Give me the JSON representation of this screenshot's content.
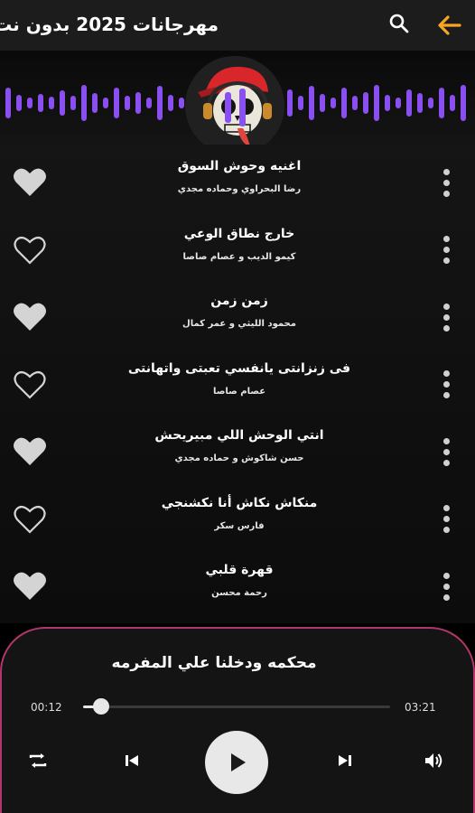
{
  "header": {
    "title": "مهرجانات 2025 بدون نت",
    "back_icon": "arrow-left-icon",
    "search_icon": "search-icon",
    "accent_color": "#f5a623"
  },
  "visualizer": {
    "bar_color": "#8a4ff0"
  },
  "songs": [
    {
      "title": "اغنيه وحوش السوق",
      "artist": "رضا البحراوي وحماده مجدي",
      "favorite": true
    },
    {
      "title": "خارج نطاق الوعي",
      "artist": "كيمو الديب و عصام صاصا",
      "favorite": false
    },
    {
      "title": "زمن زمن",
      "artist": "محمود الليثي و عمر كمال",
      "favorite": true
    },
    {
      "title": "فى زنزانتى يانفسي تعبتى واتهانتى",
      "artist": "عصام صاصا",
      "favorite": false
    },
    {
      "title": "انتي الوحش اللي مبيريحش",
      "artist": "حسن شاكوش و حماده مجدي",
      "favorite": true
    },
    {
      "title": "منكاش نكاش أنا نكشنجي",
      "artist": "فارس سكر",
      "favorite": false
    },
    {
      "title": "قهرة قلبي",
      "artist": "رحمة محسن",
      "favorite": true
    }
  ],
  "player": {
    "now_playing": "محكمه ودخلنا علي المفرمه",
    "current_time": "00:12",
    "total_time": "03:21",
    "progress": 0.06,
    "border_color": "#b2366a"
  }
}
